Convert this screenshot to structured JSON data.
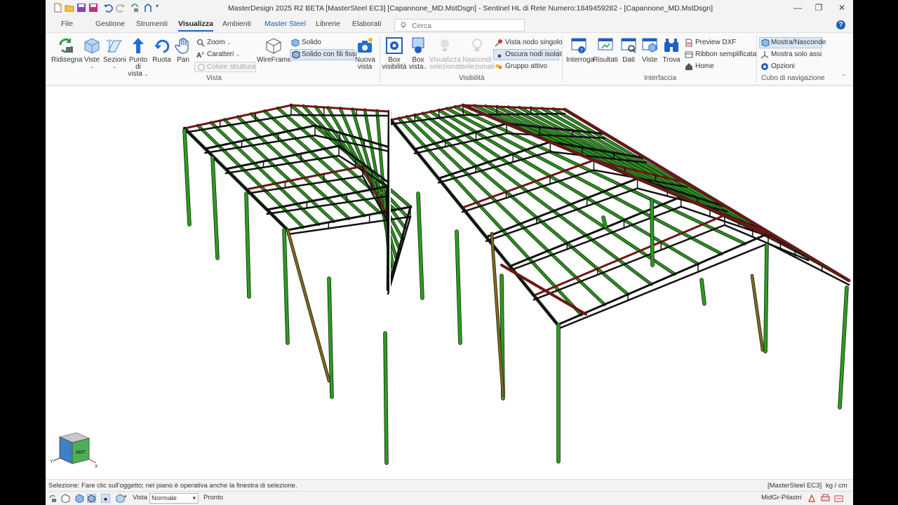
{
  "window": {
    "title": "MasterDesign 2025 R2 BETA [MasterSteel EC3] [Capannone_MD.MstDsgn]  -  Sentinel HL di Rete Numero:1849459282  -  [Capannone_MD.MstDsgn]",
    "minimize": "—",
    "restore": "❐",
    "close": "✕"
  },
  "tabs": {
    "file": "File",
    "gestione": "Gestione",
    "strumenti": "Strumenti",
    "visualizza": "Visualizza",
    "ambienti": "Ambienti",
    "master_steel": "Master Steel",
    "librerie": "Librerie",
    "elaborati": "Elaborati"
  },
  "search": {
    "placeholder": "Cerca"
  },
  "help": "?",
  "ribbon": {
    "vista": {
      "label": "Vista",
      "ridisegna": "Ridisegna",
      "viste": "Viste",
      "sezioni": "Sezioni",
      "punto_di_vista_1": "Punto di",
      "punto_di_vista_2": "vista",
      "ruota": "Ruota",
      "pan": "Pan",
      "zoom": "Zoom",
      "caratteri": "Caratteri",
      "colore_struttura": "Colore struttura",
      "wireframe": "WireFrame",
      "solido": "Solido",
      "solido_fili_fissi": "Solido con fili fissi",
      "nuova_vista_1": "Nuova",
      "nuova_vista_2": "vista"
    },
    "visibilita": {
      "label": "Visibilità",
      "box_visibilita_1": "Box",
      "box_visibilita_2": "visibilità",
      "box_vista_1": "Box",
      "box_vista_2": "vista",
      "visualizza_sel_1": "Visualizza",
      "visualizza_sel_2": "selezionati",
      "nascondi_sel_1": "Nascondi",
      "nascondi_sel_2": "selezionati",
      "vista_nodo_singolo": "Vista nodo singolo",
      "oscura_nodi_isolati": "Oscura nodi isolati",
      "gruppo_attivo": "Gruppo attivo"
    },
    "interfaccia": {
      "label": "Interfaccia",
      "interroga": "Interroga",
      "risultati": "Risultati",
      "dati": "Dati",
      "viste": "Viste",
      "trova": "Trova",
      "preview_dxf": "Preview DXF",
      "ribbon_semplificata": "Ribbon semplificata",
      "home": "Home"
    },
    "cubo": {
      "label": "Cubo di navigazione",
      "mostra_nasconde": "Mostra/Nasconde",
      "mostra_solo_assi": "Mostra solo assi",
      "opzioni": "Opzioni"
    }
  },
  "viewcube": {
    "front_label": "ANT",
    "x_axis": "X",
    "y_axis": "Y"
  },
  "colors": {
    "column": "#2f9a22",
    "purlin": "#2f8f1f",
    "rafter": "#6b1717",
    "truss": "#111111",
    "brace": "#8a6420"
  },
  "status": {
    "message": "Selezione: Fare clic sull'oggetto; nel piano è operativa anche la finestra di selezione.",
    "module": "[MasterSteel EC3]",
    "units": "kg / cm",
    "vista_label": "Vista :",
    "vista_value": "Normale",
    "ready": "Pronto",
    "layer": "MidGr-Pilastri"
  }
}
